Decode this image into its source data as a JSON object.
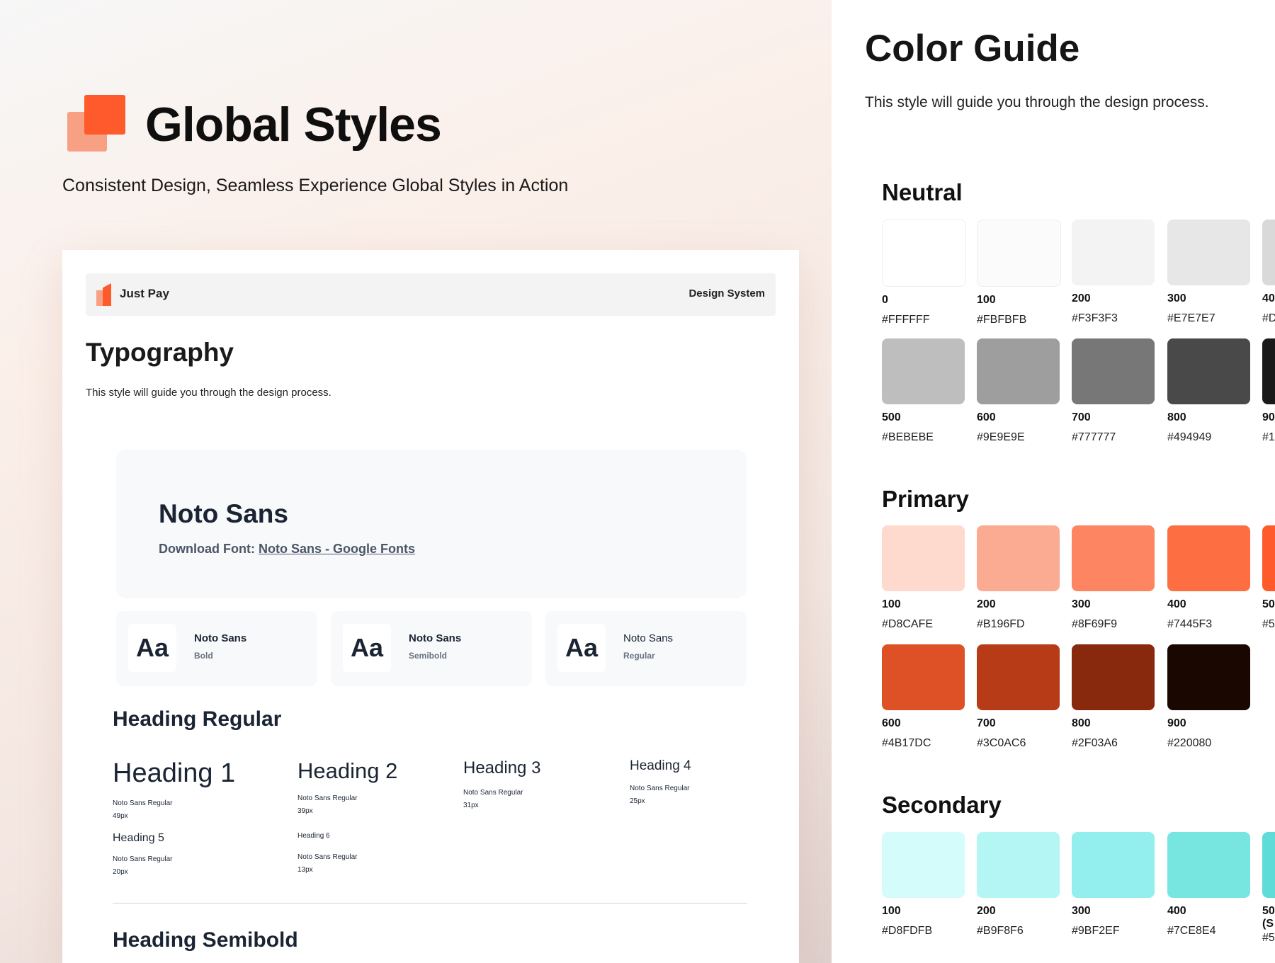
{
  "hero": {
    "title": "Global Styles",
    "subtitle": "Consistent Design, Seamless Experience Global Styles in Action"
  },
  "doc": {
    "brand": "Just Pay",
    "nav_label": "Design System",
    "title": "Typography",
    "description": "This style will guide you through the design process.",
    "font": {
      "name": "Noto Sans",
      "download_label": "Download Font:",
      "download_link": "Noto Sans - Google Fonts"
    },
    "weights": [
      {
        "sample": "Aa",
        "name": "Noto Sans",
        "weight": "Bold"
      },
      {
        "sample": "Aa",
        "name": "Noto Sans",
        "weight": "Semibold"
      },
      {
        "sample": "Aa",
        "name": "Noto Sans",
        "weight": "Regular"
      }
    ],
    "heading_regular_title": "Heading Regular",
    "headings": [
      {
        "label": "Heading 1",
        "font": "Noto Sans Regular",
        "size": "49px"
      },
      {
        "label": "Heading 2",
        "font": "Noto Sans Regular",
        "size": "39px"
      },
      {
        "label": "Heading 3",
        "font": "Noto Sans Regular",
        "size": "31px"
      },
      {
        "label": "Heading 4",
        "font": "Noto Sans Regular",
        "size": "25px"
      },
      {
        "label": "Heading 5",
        "font": "Noto Sans Regular",
        "size": "20px"
      },
      {
        "label": "Heading 6",
        "font": "Noto Sans Regular",
        "size": "13px"
      }
    ],
    "heading_semibold_title": "Heading Semibold"
  },
  "color_guide": {
    "title": "Color Guide",
    "description": "This style will guide you through the design process.",
    "neutral_title": "Neutral",
    "neutral": [
      {
        "name": "0",
        "hex": "#FFFFFF",
        "color": "#FFFFFF"
      },
      {
        "name": "100",
        "hex": "#FBFBFB",
        "color": "#FBFBFB"
      },
      {
        "name": "200",
        "hex": "#F3F3F3",
        "color": "#F3F3F3"
      },
      {
        "name": "300",
        "hex": "#E7E7E7",
        "color": "#E7E7E7"
      },
      {
        "name": "40",
        "hex": "#D",
        "color": "#D9D9D9"
      },
      {
        "name": "500",
        "hex": "#BEBEBE",
        "color": "#BEBEBE"
      },
      {
        "name": "600",
        "hex": "#9E9E9E",
        "color": "#9E9E9E"
      },
      {
        "name": "700",
        "hex": "#777777",
        "color": "#777777"
      },
      {
        "name": "800",
        "hex": "#494949",
        "color": "#494949"
      },
      {
        "name": "90",
        "hex": "#1",
        "color": "#1A1A1A"
      }
    ],
    "primary_title": "Primary",
    "primary": [
      {
        "name": "100",
        "hex": "#D8CAFE",
        "color": "#FDD9CE"
      },
      {
        "name": "200",
        "hex": "#B196FD",
        "color": "#FAAB92"
      },
      {
        "name": "300",
        "hex": "#8F69F9",
        "color": "#FD8561"
      },
      {
        "name": "400",
        "hex": "#7445F3",
        "color": "#FD6E42"
      },
      {
        "name": "50",
        "hex": "#5",
        "color": "#FF5A2B"
      },
      {
        "name": "600",
        "hex": "#4B17DC",
        "color": "#DE5026"
      },
      {
        "name": "700",
        "hex": "#3C0AC6",
        "color": "#B83B17"
      },
      {
        "name": "800",
        "hex": "#2F03A6",
        "color": "#88290D"
      },
      {
        "name": "900",
        "hex": "#220080",
        "color": "#1A0702"
      }
    ],
    "secondary_title": "Secondary",
    "secondary": [
      {
        "name": "100",
        "hex": "#D8FDFB",
        "color": "#D4FCFA"
      },
      {
        "name": "200",
        "hex": "#B9F8F6",
        "color": "#B4F6F3"
      },
      {
        "name": "300",
        "hex": "#9BF2EF",
        "color": "#93EFED"
      },
      {
        "name": "400",
        "hex": "#7CE8E4",
        "color": "#77E5E0"
      },
      {
        "name": "50\n(S",
        "hex": "#5",
        "color": "#5EDDD8"
      }
    ]
  }
}
